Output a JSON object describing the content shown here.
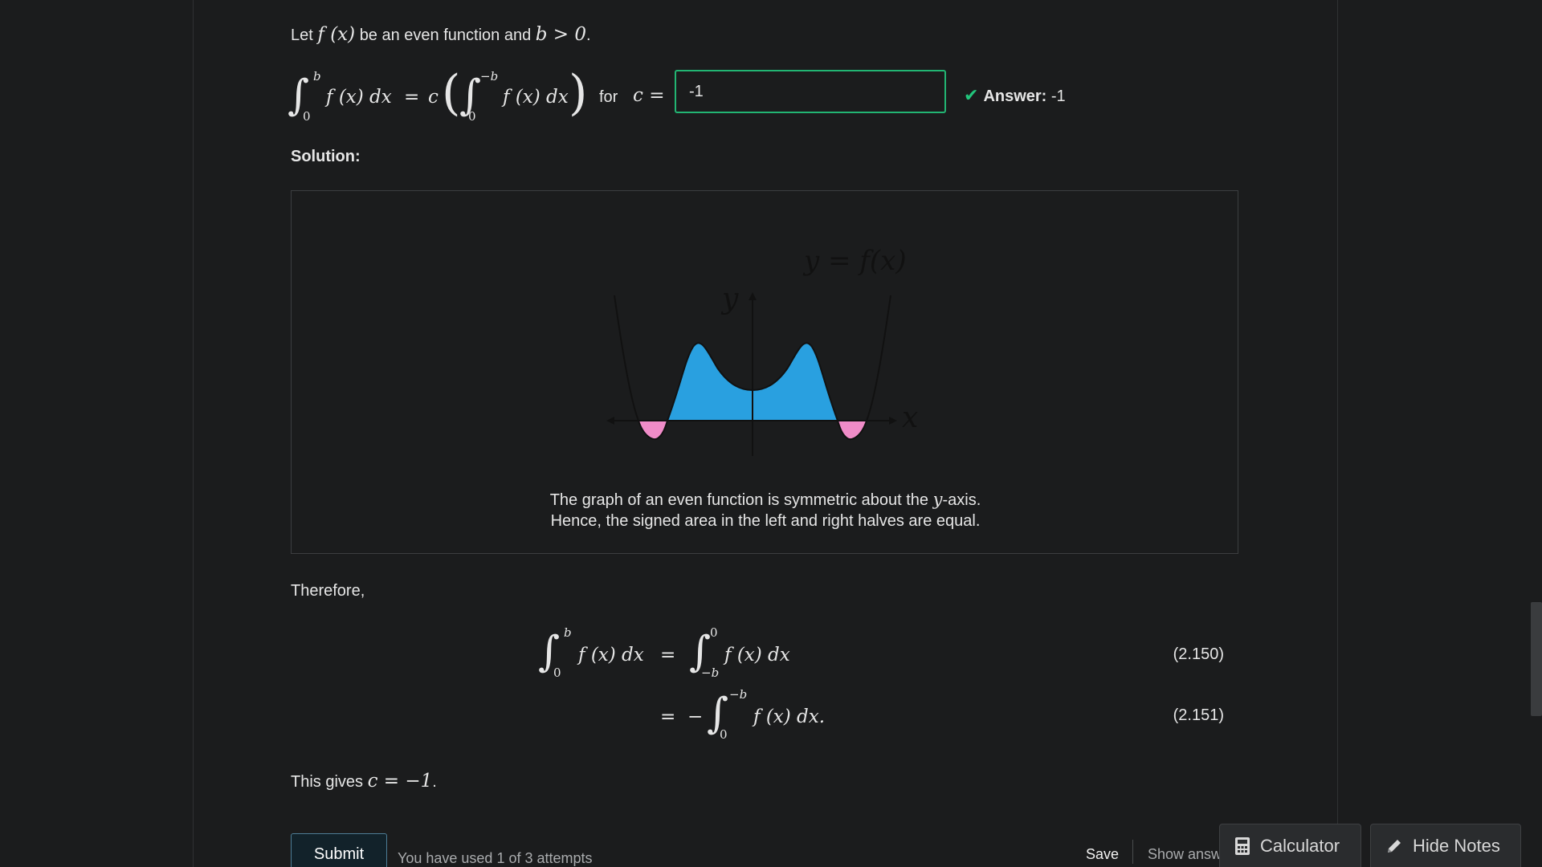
{
  "question": {
    "intro_let": "Let",
    "intro_fx": "f (x)",
    "intro_mid": "be an even function and",
    "intro_cond": "b > 0",
    "intro_end": ".",
    "for_label": "for",
    "c_eq": "c =",
    "input_value": "-1",
    "answer_label": "Answer:",
    "answer_value": " -1"
  },
  "solution": {
    "label": "Solution:",
    "graph": {
      "curve_label": "y = f(x)",
      "x_axis_label": "x",
      "y_axis_label": "y",
      "positive_color": "#29a0e0",
      "negative_color": "#f08cc8"
    },
    "caption_line1_a": "The graph of an even function is symmetric about the ",
    "caption_line1_var": "y",
    "caption_line1_b": "-axis.",
    "caption_line2": "Hence, the signed area in the left and right halves are equal.",
    "therefore": "Therefore,",
    "eq1_number": "(2.150)",
    "eq2_number": "(2.151)",
    "conclusion_a": "This gives ",
    "conclusion_math": "c = −1",
    "conclusion_b": "."
  },
  "actions": {
    "submit_label": "Submit",
    "attempts_text": "You have used 1 of 3 attempts",
    "save_label": "Save",
    "show_answer_label": "Show answ"
  },
  "tools": {
    "calculator_label": "Calculator",
    "hide_notes_label": "Hide Notes"
  },
  "colors": {
    "background": "#1b1c1d",
    "correct_border": "#22b573",
    "check_icon": "#22c57c"
  }
}
